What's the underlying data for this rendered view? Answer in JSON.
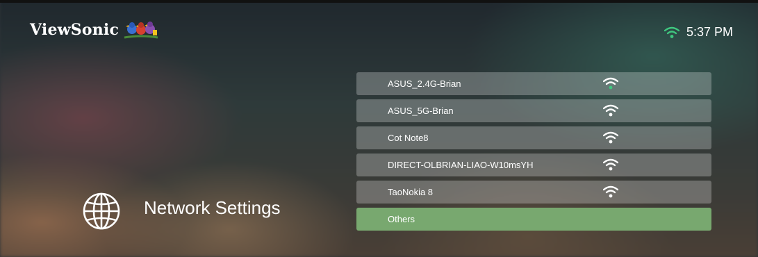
{
  "brand": {
    "name": "ViewSonic",
    "logo_icon": "birds-logo"
  },
  "status_bar": {
    "wifi_icon": "wifi-icon",
    "wifi_color": "#3fc77f",
    "time": "5:37 PM"
  },
  "page": {
    "title": "Network Settings",
    "icon": "globe-icon"
  },
  "networks": [
    {
      "name": "ASUS_2.4G-Brian",
      "signal_icon": "wifi-signal-icon",
      "connected": true
    },
    {
      "name": "ASUS_5G-Brian",
      "signal_icon": "wifi-signal-icon",
      "connected": false
    },
    {
      "name": "Cot Note8",
      "signal_icon": "wifi-signal-icon",
      "connected": false
    },
    {
      "name": "DIRECT-OLBRIAN-LIAO-W10msYH",
      "signal_icon": "wifi-signal-icon",
      "connected": false
    },
    {
      "name": "TaoNokia 8",
      "signal_icon": "wifi-signal-icon",
      "connected": false
    },
    {
      "name": "Others",
      "selected": true
    }
  ],
  "colors": {
    "selected_row": "#78a86f",
    "connected_dot": "#3fc77f"
  }
}
